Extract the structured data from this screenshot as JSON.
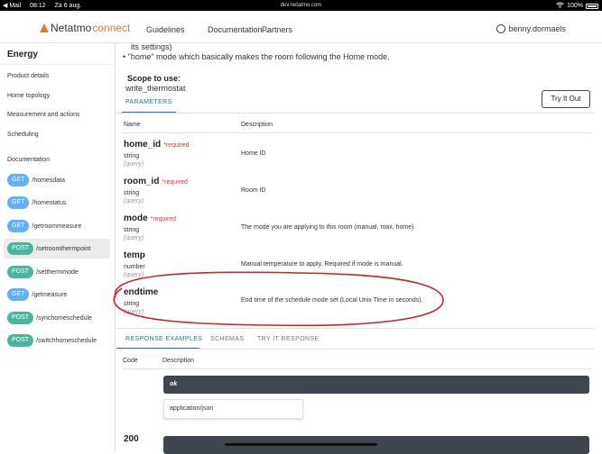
{
  "statusbar": {
    "back_app": "◀ Mail",
    "time": "08:12",
    "date": "Za 6 aug.",
    "url": "dev.netatmo.com",
    "battery": "100%"
  },
  "topnav": {
    "brand": "Netatmo",
    "brand_sub": "connect",
    "links": [
      "Guidelines",
      "Documentation",
      "Partners"
    ],
    "user": "benny.dormaels"
  },
  "sidebar": {
    "title": "Energy",
    "items": [
      "Product details",
      "Home topology",
      "Measurement and actions",
      "Scheduling",
      "Documentation"
    ],
    "endpoints": [
      {
        "method": "GET",
        "path": "/homesdata"
      },
      {
        "method": "GET",
        "path": "/homestatus"
      },
      {
        "method": "GET",
        "path": "/getroommeasure"
      },
      {
        "method": "POST",
        "path": "/setroomthermpoint"
      },
      {
        "method": "POST",
        "path": "/setthermmode"
      },
      {
        "method": "GET",
        "path": "/getmeasure"
      },
      {
        "method": "POST",
        "path": "/synchomeschedule"
      },
      {
        "method": "POST",
        "path": "/switchhomeschedule"
      }
    ]
  },
  "content": {
    "intro_line1": "its settings)",
    "intro_bullet": "\"home\" mode which basically makes the room following the Home mode.",
    "scope_label": "Scope to use:",
    "scope_value": "write_thermostat",
    "try_button": "Try It Out",
    "params_tab": "PARAMETERS",
    "col_name": "Name",
    "col_desc": "Description",
    "required_label": "*required",
    "params": [
      {
        "name": "home_id",
        "required": true,
        "type": "string",
        "in": "(query)",
        "desc": "Home ID"
      },
      {
        "name": "room_id",
        "required": true,
        "type": "string",
        "in": "(query)",
        "desc": "Room ID"
      },
      {
        "name": "mode",
        "required": true,
        "type": "string",
        "in": "(query)",
        "desc": "The mode you are applying to this room (manual, max, home)"
      },
      {
        "name": "temp",
        "required": false,
        "type": "number",
        "in": "(query)",
        "desc": "Manual temperature to apply. Required if mode is manual."
      },
      {
        "name": "endtime",
        "required": false,
        "type": "string",
        "in": "(query)",
        "desc": "End time of the schedule mode set (Local Unix Time in seconds)."
      }
    ],
    "response_tabs": [
      "RESPONSE EXAMPLES",
      "SCHEMAS",
      "TRY IT RESPONSE"
    ],
    "resp_col_code": "Code",
    "resp_col_desc": "Description",
    "ok_label": "ok",
    "content_type": "application/json",
    "code_200": "200"
  },
  "colors": {
    "accent": "#2a6fa8",
    "get": "#61affe",
    "post": "#49b59f",
    "required": "#d53c3c",
    "annotation": "#d0212b",
    "brand_orange": "#e37b2e"
  }
}
